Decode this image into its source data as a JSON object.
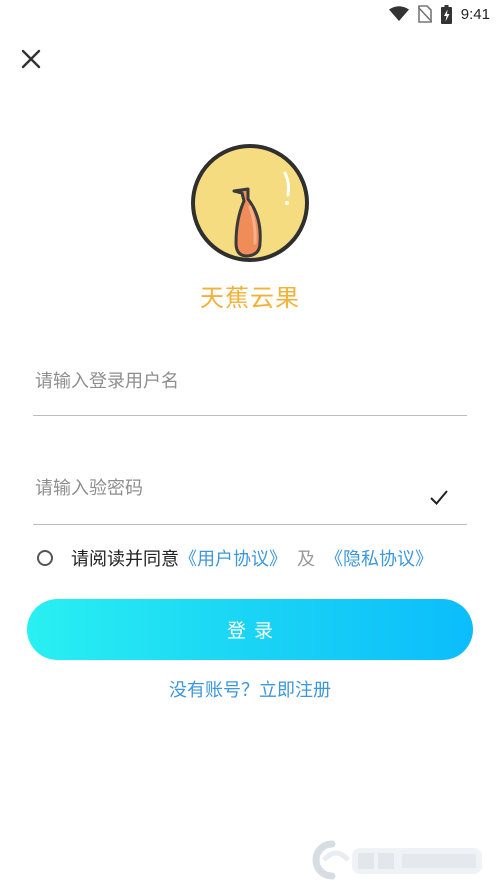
{
  "status_bar": {
    "time": "9:41",
    "icons": [
      "wifi-icon",
      "no-sim-icon",
      "battery-charging-icon"
    ]
  },
  "header": {
    "close_icon": "close-icon"
  },
  "app": {
    "name": "天蕉云果",
    "logo": "banana-logo"
  },
  "form": {
    "username_placeholder": "请输入登录用户名",
    "code_placeholder": "请输入验密码",
    "toggle_icon": "check-icon"
  },
  "agreement": {
    "prefix": "请阅读并同意",
    "user_agreement": "《用户协议》",
    "and": "及",
    "privacy_policy": "《隐私协议》"
  },
  "login_button": "登录",
  "register_link": "没有账号？立即注册",
  "colors": {
    "brand": "#f3b139",
    "link": "#3d97dc",
    "button_gradient_start": "#29f0f2",
    "button_gradient_end": "#0bbdfb"
  }
}
